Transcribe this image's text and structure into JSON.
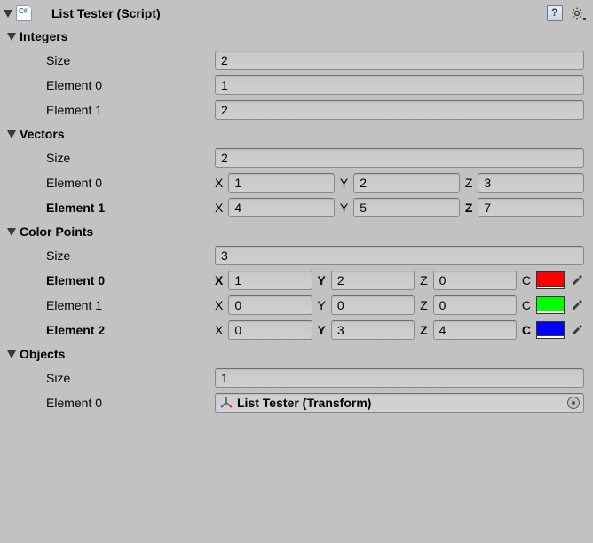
{
  "header": {
    "title": "List Tester (Script)"
  },
  "sections": {
    "integers": {
      "title": "Integers",
      "size_label": "Size",
      "size_value": "2",
      "elements": [
        {
          "label": "Element 0",
          "value": "1",
          "bold": false
        },
        {
          "label": "Element 1",
          "value": "2",
          "bold": false
        }
      ]
    },
    "vectors": {
      "title": "Vectors",
      "size_label": "Size",
      "size_value": "2",
      "axis_x": "X",
      "axis_y": "Y",
      "axis_z": "Z",
      "elements": [
        {
          "label": "Element 0",
          "bold": false,
          "x": "1",
          "y": "2",
          "z": "3",
          "bold_z": false
        },
        {
          "label": "Element 1",
          "bold": true,
          "x": "4",
          "y": "5",
          "z": "7",
          "bold_z": true
        }
      ]
    },
    "color_points": {
      "title": "Color Points",
      "size_label": "Size",
      "size_value": "3",
      "axis_x": "X",
      "axis_y": "Y",
      "axis_z": "Z",
      "axis_c": "C",
      "elements": [
        {
          "label": "Element 0",
          "bold": true,
          "x": "1",
          "y": "2",
          "z": "0",
          "color": "#ff0000"
        },
        {
          "label": "Element 1",
          "bold": false,
          "x": "0",
          "y": "0",
          "z": "0",
          "color": "#00ff00"
        },
        {
          "label": "Element 2",
          "bold": true,
          "x": "0",
          "y": "3",
          "z": "4",
          "color": "#0000ff"
        }
      ]
    },
    "objects": {
      "title": "Objects",
      "size_label": "Size",
      "size_value": "1",
      "elements": [
        {
          "label": "Element 0",
          "value": "List Tester (Transform)"
        }
      ]
    }
  }
}
